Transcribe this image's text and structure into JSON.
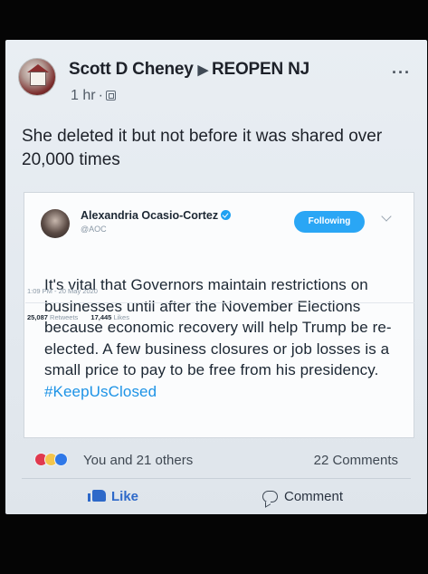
{
  "post": {
    "author": "Scott D Cheney",
    "group": "REOPEN NJ",
    "time": "1 hr",
    "text": "She deleted it but not before it was shared over 20,000 times"
  },
  "tweet": {
    "name": "Alexandria Ocasio-Cortez",
    "handle": "@AOC",
    "follow_label": "Following",
    "body": "It's vital that Governors maintain restrictions on businesses until after the November Elections because economic recovery will help Trump be re-elected. A few business closures or job losses is a small price to pay to be free from his presidency.",
    "hashtag": "#KeepUsClosed",
    "timestamp": "1:09 PM - 20 May 2020",
    "retweets_count": "25,087",
    "retweets_label": "Retweets",
    "likes_count": "17,445",
    "likes_label": "Likes"
  },
  "engagement": {
    "reactions_text": "You and 21 others",
    "comments_text": "22 Comments",
    "like_label": "Like",
    "comment_label": "Comment"
  },
  "icons": [
    "globe-icon",
    "more-icon",
    "verified-icon",
    "chevron-down-icon",
    "heart-icon",
    "wow-icon",
    "like-icon",
    "thumb-icon",
    "bubble-icon"
  ],
  "colors": {
    "twitter_blue": "#1da1f2",
    "facebook_blue": "#2e69c9",
    "heart_red": "#e0394e"
  }
}
